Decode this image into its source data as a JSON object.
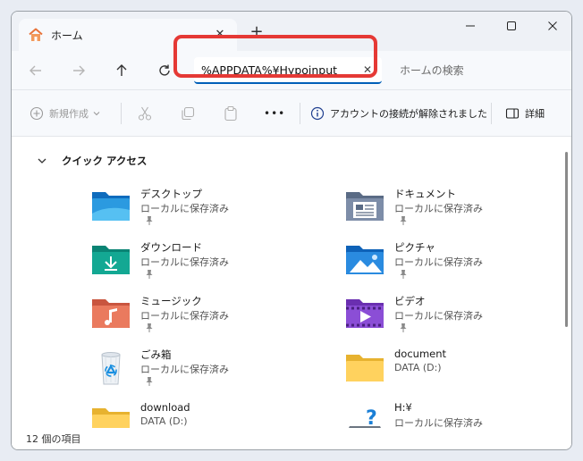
{
  "tab": {
    "title": "ホーム",
    "close": "✕",
    "new_tab": "+"
  },
  "address": {
    "value": "%APPDATA%¥Hypoinput",
    "clear": "✕"
  },
  "search": {
    "placeholder": "ホームの検索"
  },
  "commands": {
    "new": "新規作成",
    "more": "•••",
    "notice": "アカウントの接続が解除されました",
    "details": "詳細"
  },
  "section": {
    "title": "クイック アクセス"
  },
  "items": [
    {
      "name": "デスクトップ",
      "sub": "ローカルに保存済み",
      "icon": "desktop-folder-icon",
      "pinned": true
    },
    {
      "name": "ドキュメント",
      "sub": "ローカルに保存済み",
      "icon": "documents-folder-icon",
      "pinned": true
    },
    {
      "name": "ダウンロード",
      "sub": "ローカルに保存済み",
      "icon": "downloads-folder-icon",
      "pinned": true
    },
    {
      "name": "ピクチャ",
      "sub": "ローカルに保存済み",
      "icon": "pictures-folder-icon",
      "pinned": true
    },
    {
      "name": "ミュージック",
      "sub": "ローカルに保存済み",
      "icon": "music-folder-icon",
      "pinned": true
    },
    {
      "name": "ビデオ",
      "sub": "ローカルに保存済み",
      "icon": "videos-folder-icon",
      "pinned": true
    },
    {
      "name": "ごみ箱",
      "sub": "ローカルに保存済み",
      "icon": "recycle-bin-icon",
      "pinned": true
    },
    {
      "name": "document",
      "sub": "DATA (D:)",
      "icon": "folder-icon",
      "pinned": false
    },
    {
      "name": "download",
      "sub": "DATA (D:)",
      "icon": "folder-icon",
      "pinned": false
    },
    {
      "name": "H:¥",
      "sub": "ローカルに保存済み",
      "icon": "unknown-drive-icon",
      "pinned": false
    }
  ],
  "status": {
    "count": "12 個の項目"
  },
  "colors": {
    "accent": "#005fb8",
    "highlight": "#e53935"
  }
}
